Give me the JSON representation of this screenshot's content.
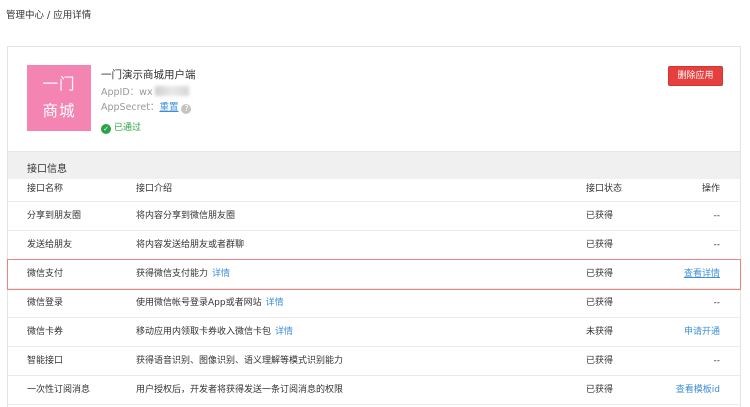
{
  "breadcrumb": "管理中心 / 应用详情",
  "app": {
    "logo_line1": "一门",
    "logo_line2": "商城",
    "name": "一门演示商城用户端",
    "appid_label": "AppID：wx",
    "appsecret_label": "AppSecret：",
    "reset_link": "重置",
    "help_glyph": "?",
    "status": "已通过",
    "delete_button": "删除应用"
  },
  "section_title": "接口信息",
  "table": {
    "headers": {
      "name": "接口名称",
      "desc": "接口介绍",
      "status": "接口状态",
      "op": "操作"
    },
    "rows": [
      {
        "name": "分享到朋友圈",
        "desc": "将内容分享到微信朋友圈",
        "detail": "",
        "status": "已获得",
        "op": "--"
      },
      {
        "name": "发送给朋友",
        "desc": "将内容发送给朋友或者群聊",
        "detail": "",
        "status": "已获得",
        "op": "--"
      },
      {
        "name": "微信支付",
        "desc": "获得微信支付能力",
        "detail": "详情",
        "status": "已获得",
        "op": "查看详情"
      },
      {
        "name": "微信登录",
        "desc": "使用微信帐号登录App或者网站",
        "detail": "详情",
        "status": "已获得",
        "op": "--"
      },
      {
        "name": "微信卡券",
        "desc": "移动应用内领取卡券收入微信卡包",
        "detail": "详情",
        "status": "未获得",
        "op": "申请开通"
      },
      {
        "name": "智能接口",
        "desc": "获得语音识别、图像识别、语义理解等模式识别能力",
        "detail": "",
        "status": "已获得",
        "op": "--"
      },
      {
        "name": "一次性订阅消息",
        "desc": "用户授权后，开发者将获得发送一条订阅消息的权限",
        "detail": "",
        "status": "已获得",
        "op": "查看模板id"
      }
    ]
  },
  "colors": {
    "logo_bg": "#f485b3",
    "delete_bg": "#e6403e",
    "link": "#3b8fd9",
    "approved": "#2ba245",
    "highlight_border": "#e8837f"
  }
}
